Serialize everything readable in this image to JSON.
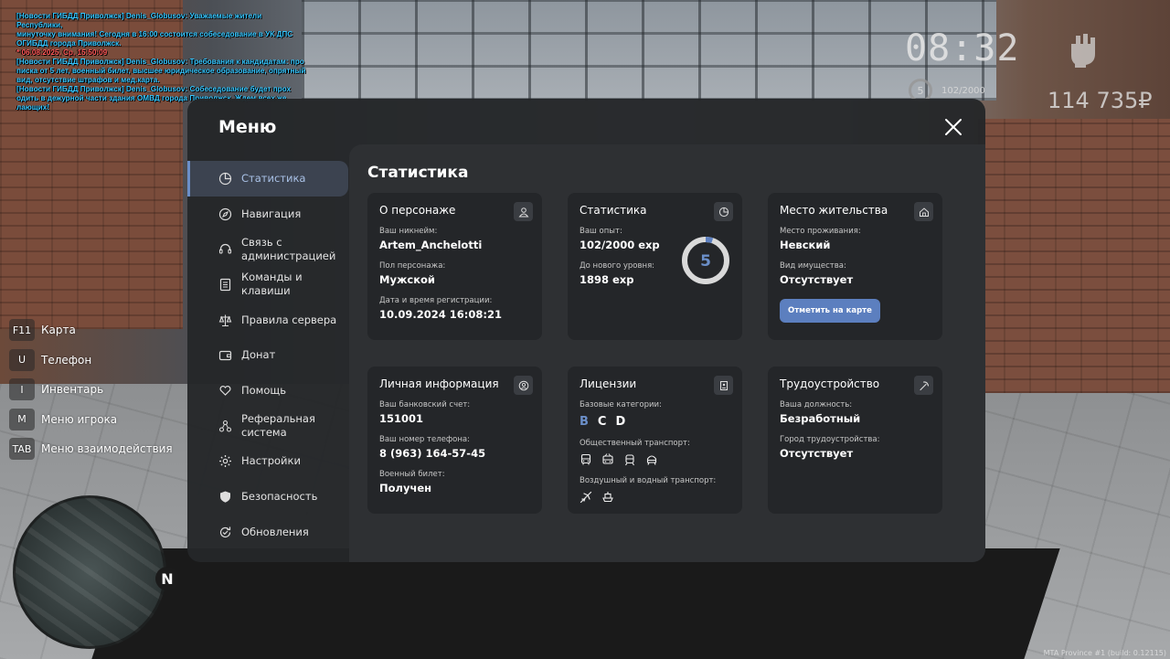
{
  "chat": [
    {
      "text": "[Новости ГИБДД Приволжск] Denis_Globusov: Уважаемые жители Республики,",
      "color": "#35c6ff"
    },
    {
      "text": "  минуточку внимания! Сегодня в 16:00 состоится собеседование в УК ДПС",
      "color": "#35c6ff"
    },
    {
      "text": "  ОГИБДД города Приволжск.",
      "color": "#35c6ff"
    },
    {
      "text": " * 06.08.2025, Ср, 15:50:09",
      "color": "#ff5656"
    },
    {
      "text": "[Новости ГИБДД Приволжск] Denis_Globusov: Требования к кандидатам: про",
      "color": "#35c6ff"
    },
    {
      "text": "  писка от 5 лет, военный билет, высшее юридическое образование, опрятный",
      "color": "#35c6ff"
    },
    {
      "text": "  вид, отсутствие штрафов и мед.карта.",
      "color": "#35c6ff"
    },
    {
      "text": "[Новости ГИБДД Приволжск] Denis_Globusov: Собеседование будет прох",
      "color": "#35c6ff"
    },
    {
      "text": "  одить в дежурной части здания ОМВД города Приволжск. Ждем всех же",
      "color": "#35c6ff"
    },
    {
      "text": "  лающих!",
      "color": "#35c6ff"
    }
  ],
  "hud": {
    "clock": "08:32",
    "level": "5",
    "exp": "102/2000",
    "money": "114 735₽",
    "fist_icon": "fist-icon"
  },
  "keybinds": [
    {
      "key": "F11",
      "label": "Карта"
    },
    {
      "key": "U",
      "label": "Телефон"
    },
    {
      "key": "I",
      "label": "Инвентарь"
    },
    {
      "key": "M",
      "label": "Меню игрока"
    },
    {
      "key": "TAB",
      "label": "Меню взаимодействия"
    }
  ],
  "minimap": {
    "north": "N"
  },
  "build": "MTA Province #1 (build: 0.12115)",
  "menu": {
    "title": "Меню",
    "accent": "#6b8fc9",
    "sidebar": [
      {
        "label": "Статистика",
        "icon": "pie-chart-icon",
        "active": true
      },
      {
        "label": "Навигация",
        "icon": "compass-icon"
      },
      {
        "label": "Связь с администрацией",
        "icon": "headset-icon"
      },
      {
        "label": "Команды и клавиши",
        "icon": "document-icon"
      },
      {
        "label": "Правила сервера",
        "icon": "scales-icon"
      },
      {
        "label": "Донат",
        "icon": "wallet-icon"
      },
      {
        "label": "Помощь",
        "icon": "heart-hand-icon"
      },
      {
        "label": "Реферальная система",
        "icon": "network-icon"
      },
      {
        "label": "Настройки",
        "icon": "gear-icon"
      },
      {
        "label": "Безопасность",
        "icon": "shield-icon"
      },
      {
        "label": "Обновления",
        "icon": "refresh-check-icon"
      }
    ],
    "content_title": "Статистика",
    "character": {
      "title": "О персонаже",
      "nickname_label": "Ваш никнейм:",
      "nickname": "Artem_Anchelotti",
      "gender_label": "Пол персонажа:",
      "gender": "Мужской",
      "reg_label": "Дата и время регистрации:",
      "reg": "10.09.2024 16:08:21"
    },
    "stats": {
      "title": "Статистика",
      "exp_label": "Ваш опыт:",
      "exp": "102/2000 exp",
      "next_label": "До нового уровня:",
      "next": "1898 exp",
      "level": "5",
      "progress": 0.051
    },
    "residence": {
      "title": "Место жительства",
      "place_label": "Место проживания:",
      "place": "Невский",
      "property_label": "Вид имущества:",
      "property": "Отсутствует",
      "button": "Отметить на карте"
    },
    "personal": {
      "title": "Личная информация",
      "bank_label": "Ваш банковский счет:",
      "bank": "151001",
      "phone_label": "Ваш номер телефона:",
      "phone": "8 (963) 164-57-45",
      "military_label": "Военный билет:",
      "military": "Получен"
    },
    "licenses": {
      "title": "Лицензии",
      "base_label": "Базовые категории:",
      "categories": [
        {
          "name": "B",
          "active": true
        },
        {
          "name": "C",
          "active": false
        },
        {
          "name": "D",
          "active": false
        }
      ],
      "public_label": "Общественный транспорт:",
      "air_label": "Воздушный и водный транспорт:"
    },
    "employment": {
      "title": "Трудоустройство",
      "position_label": "Ваша должность:",
      "position": "Безработный",
      "city_label": "Город трудоустройства:",
      "city": "Отсутствует"
    }
  }
}
